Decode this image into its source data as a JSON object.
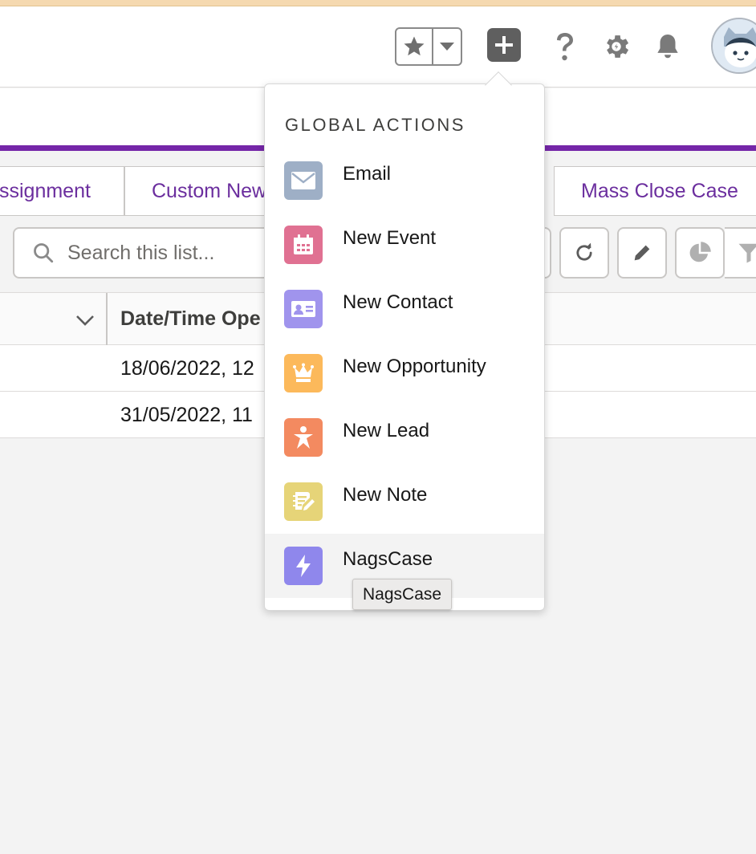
{
  "header": {
    "favorites_label": "★",
    "colors": {
      "header_bg": "#ffffff",
      "icon_gray": "#8a8a8a",
      "plus_bg": "#5f5f5f"
    }
  },
  "object_actions": [
    "ssignment",
    "Custom New",
    "Mass Close Case"
  ],
  "list": {
    "search_placeholder": "Search this list...",
    "column_header": "Date/Time Ope",
    "rows": [
      "18/06/2022, 12",
      "31/05/2022, 11"
    ]
  },
  "global_actions": {
    "heading": "GLOBAL ACTIONS",
    "items": [
      {
        "label": "Email",
        "icon": "email-icon",
        "color": "#9eafc6"
      },
      {
        "label": "New Event",
        "icon": "calendar-icon",
        "color": "#e07192"
      },
      {
        "label": "New Contact",
        "icon": "contact-card-icon",
        "color": "#a094ed"
      },
      {
        "label": "New Opportunity",
        "icon": "crown-icon",
        "color": "#fcb95b"
      },
      {
        "label": "New Lead",
        "icon": "person-star-icon",
        "color": "#f38a60"
      },
      {
        "label": "New Note",
        "icon": "note-icon",
        "color": "#e6d478"
      },
      {
        "label": "NagsCase",
        "icon": "lightning-icon",
        "color": "#8f87ec"
      }
    ],
    "tooltip": "NagsCase"
  },
  "accent_color": "#7526a8"
}
